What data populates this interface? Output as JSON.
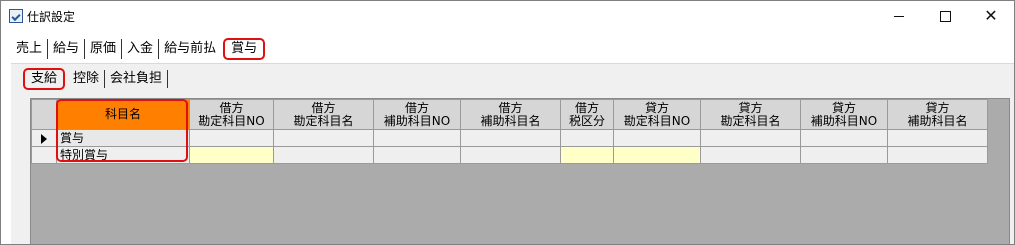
{
  "window": {
    "title": "仕訳設定"
  },
  "main_tabs": [
    "売上",
    "給与",
    "原価",
    "入金",
    "給与前払",
    "賞与"
  ],
  "sub_tabs": [
    "支給",
    "控除",
    "会社負担"
  ],
  "grid": {
    "columns": [
      {
        "line1": "科目名",
        "line2": ""
      },
      {
        "line1": "借方",
        "line2": "勘定科目NO"
      },
      {
        "line1": "借方",
        "line2": "勘定科目名"
      },
      {
        "line1": "借方",
        "line2": "補助科目NO"
      },
      {
        "line1": "借方",
        "line2": "補助科目名"
      },
      {
        "line1": "借方",
        "line2": "税区分"
      },
      {
        "line1": "貸方",
        "line2": "勘定科目NO"
      },
      {
        "line1": "貸方",
        "line2": "勘定科目名"
      },
      {
        "line1": "貸方",
        "line2": "補助科目NO"
      },
      {
        "line1": "貸方",
        "line2": "補助科目名"
      }
    ],
    "rows": [
      {
        "name": "賞与"
      },
      {
        "name": "特別賞与"
      }
    ]
  },
  "colors": {
    "header_accent": "#ff8000",
    "highlight": "#e01010",
    "input_cell": "#ffffc8"
  }
}
